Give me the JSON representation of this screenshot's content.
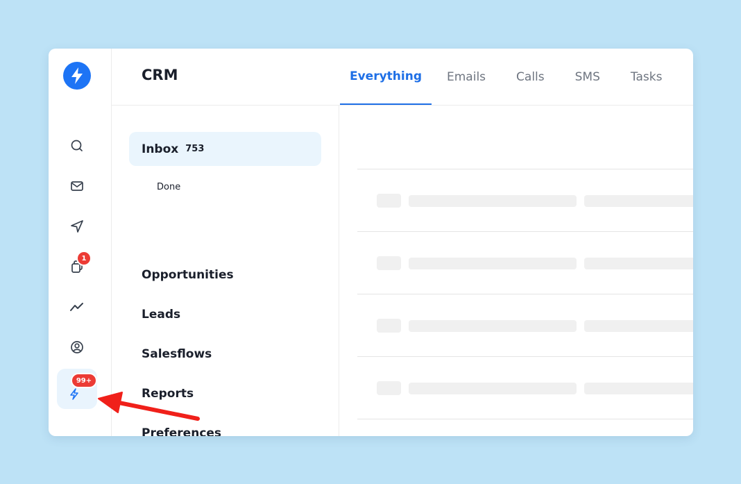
{
  "app": {
    "title": "CRM",
    "accent_color": "#1d74f5",
    "logo_icon": "lightning-bolt-icon"
  },
  "rail": {
    "items": [
      {
        "name": "search",
        "icon": "search-icon"
      },
      {
        "name": "inbox",
        "icon": "mail-icon"
      },
      {
        "name": "send",
        "icon": "send-icon"
      },
      {
        "name": "sequences",
        "icon": "copy-icon",
        "badge": "1"
      },
      {
        "name": "analytics",
        "icon": "trend-line-icon"
      },
      {
        "name": "profile",
        "icon": "user-circle-icon"
      },
      {
        "name": "activity",
        "icon": "lightning-icon",
        "badge": "99+"
      }
    ],
    "badge_color": "#ec3b35"
  },
  "tabs": [
    {
      "label": "Everything",
      "active": true
    },
    {
      "label": "Emails"
    },
    {
      "label": "Calls"
    },
    {
      "label": "SMS"
    },
    {
      "label": "Tasks"
    }
  ],
  "nav": {
    "inbox": {
      "label": "Inbox",
      "count": "753"
    },
    "done": {
      "label": "Done"
    },
    "opportunities": {
      "label": "Opportunities"
    },
    "leads": {
      "label": "Leads"
    },
    "salesflows": {
      "label": "Salesflows"
    },
    "reports": {
      "label": "Reports"
    },
    "preferences": {
      "label": "Preferences"
    }
  },
  "annotation": {
    "type": "arrow",
    "color": "#f0201a",
    "points_to": "activity"
  }
}
